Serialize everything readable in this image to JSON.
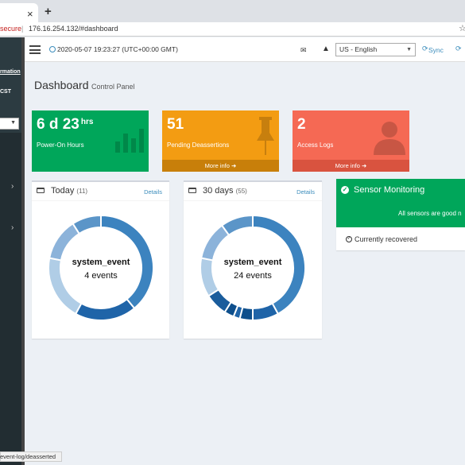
{
  "browser": {
    "tab_close": "×",
    "new_tab": "+",
    "security": "secure",
    "url": "176.16.254.132/#dashboard",
    "status_url": "event-log/deasserted"
  },
  "sidebar": {
    "info_label": "rmation",
    "time_label": "CST"
  },
  "topbar": {
    "datetime": "2020-05-07 19:23:27 (UTC+00:00 GMT)",
    "language": "US - English",
    "sync": "Sync"
  },
  "page": {
    "title": "Dashboard",
    "subtitle": "Control Panel"
  },
  "boxes": {
    "power": {
      "value": "6 d 23",
      "unit": "hrs",
      "label": "Power-On Hours",
      "color": "#00a65a"
    },
    "pending": {
      "value": "51",
      "label": "Pending Deassertions",
      "more": "More info",
      "color": "#f39c12"
    },
    "access": {
      "value": "2",
      "label": "Access Logs",
      "more": "More info",
      "color": "#f56954"
    }
  },
  "today": {
    "title": "Today",
    "count": "(11)",
    "details": "Details",
    "center_label": "system_event",
    "center_value": "4 events",
    "segments": [
      {
        "value": 0.39,
        "color": "#3c83bf"
      },
      {
        "value": 0.19,
        "color": "#1f64a8"
      },
      {
        "value": 0.2,
        "color": "#b0cde6"
      },
      {
        "value": 0.13,
        "color": "#8cb3da"
      },
      {
        "value": 0.09,
        "color": "#5b95c8"
      }
    ]
  },
  "thirty": {
    "title": "30 days",
    "count": "(55)",
    "details": "Details",
    "center_label": "system_event",
    "center_value": "24 events",
    "segments": [
      {
        "value": 0.42,
        "color": "#3c83bf"
      },
      {
        "value": 0.08,
        "color": "#1f64a8"
      },
      {
        "value": 0.04,
        "color": "#0e4f8c"
      },
      {
        "value": 0.02,
        "color": "#1f64a8"
      },
      {
        "value": 0.03,
        "color": "#0e4f8c"
      },
      {
        "value": 0.07,
        "color": "#1a5c9c"
      },
      {
        "value": 0.12,
        "color": "#b0cde6"
      },
      {
        "value": 0.12,
        "color": "#8cb3da"
      },
      {
        "value": 0.1,
        "color": "#5b95c8"
      }
    ]
  },
  "sensor": {
    "title": "Sensor Monitoring",
    "message": "All sensors are good n",
    "recovered": "Currently recovered"
  }
}
